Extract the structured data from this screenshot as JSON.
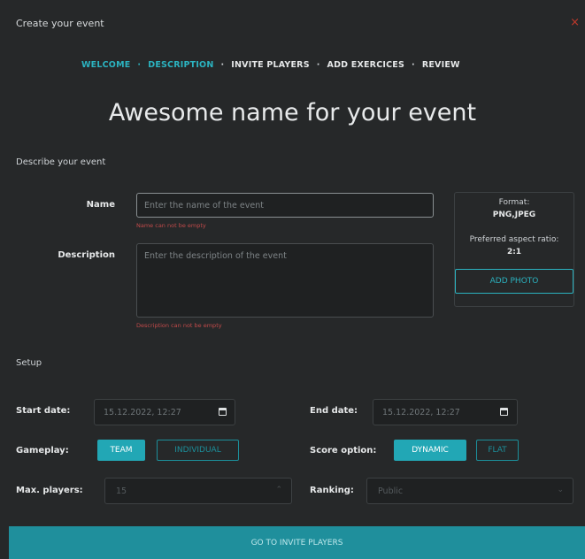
{
  "header": {
    "title": "Create your event",
    "close_icon": "close-icon"
  },
  "steps": [
    {
      "label": "WELCOME",
      "active": true
    },
    {
      "label": "DESCRIPTION",
      "active": true
    },
    {
      "label": "INVITE PLAYERS",
      "active": false
    },
    {
      "label": "ADD EXERCICES",
      "active": false
    },
    {
      "label": "REVIEW",
      "active": false
    }
  ],
  "heading": "Awesome name for your event",
  "describe": {
    "section_label": "Describe your event",
    "name": {
      "label": "Name",
      "placeholder": "Enter the name of the event",
      "error": "Name can not be empty"
    },
    "description": {
      "label": "Description",
      "placeholder": "Enter the description of the event",
      "error": "Description can not be empty"
    }
  },
  "photo": {
    "format_title": "Format:",
    "format_value": "PNG,JPEG",
    "ratio_title": "Preferred aspect ratio:",
    "ratio_value": "2:1",
    "button": "ADD PHOTO"
  },
  "setup": {
    "section_label": "Setup",
    "start_date": {
      "label": "Start date:",
      "value": "15.12.2022, 12:27"
    },
    "end_date": {
      "label": "End date:",
      "value": "15.12.2022, 12:27"
    },
    "gameplay": {
      "label": "Gameplay:",
      "options": [
        "TEAM",
        "INDIVIDUAL"
      ],
      "selected": "TEAM"
    },
    "score": {
      "label": "Score option:",
      "options": [
        "DYNAMIC",
        "FLAT"
      ],
      "selected": "DYNAMIC"
    },
    "max_players": {
      "label": "Max. players:",
      "value": "15"
    },
    "ranking": {
      "label": "Ranking:",
      "value": "Public"
    }
  },
  "footer": {
    "button": "GO TO INVITE PLAYERS"
  },
  "colors": {
    "accent": "#22a7b5",
    "background": "#262829",
    "error": "#c24a4a"
  }
}
